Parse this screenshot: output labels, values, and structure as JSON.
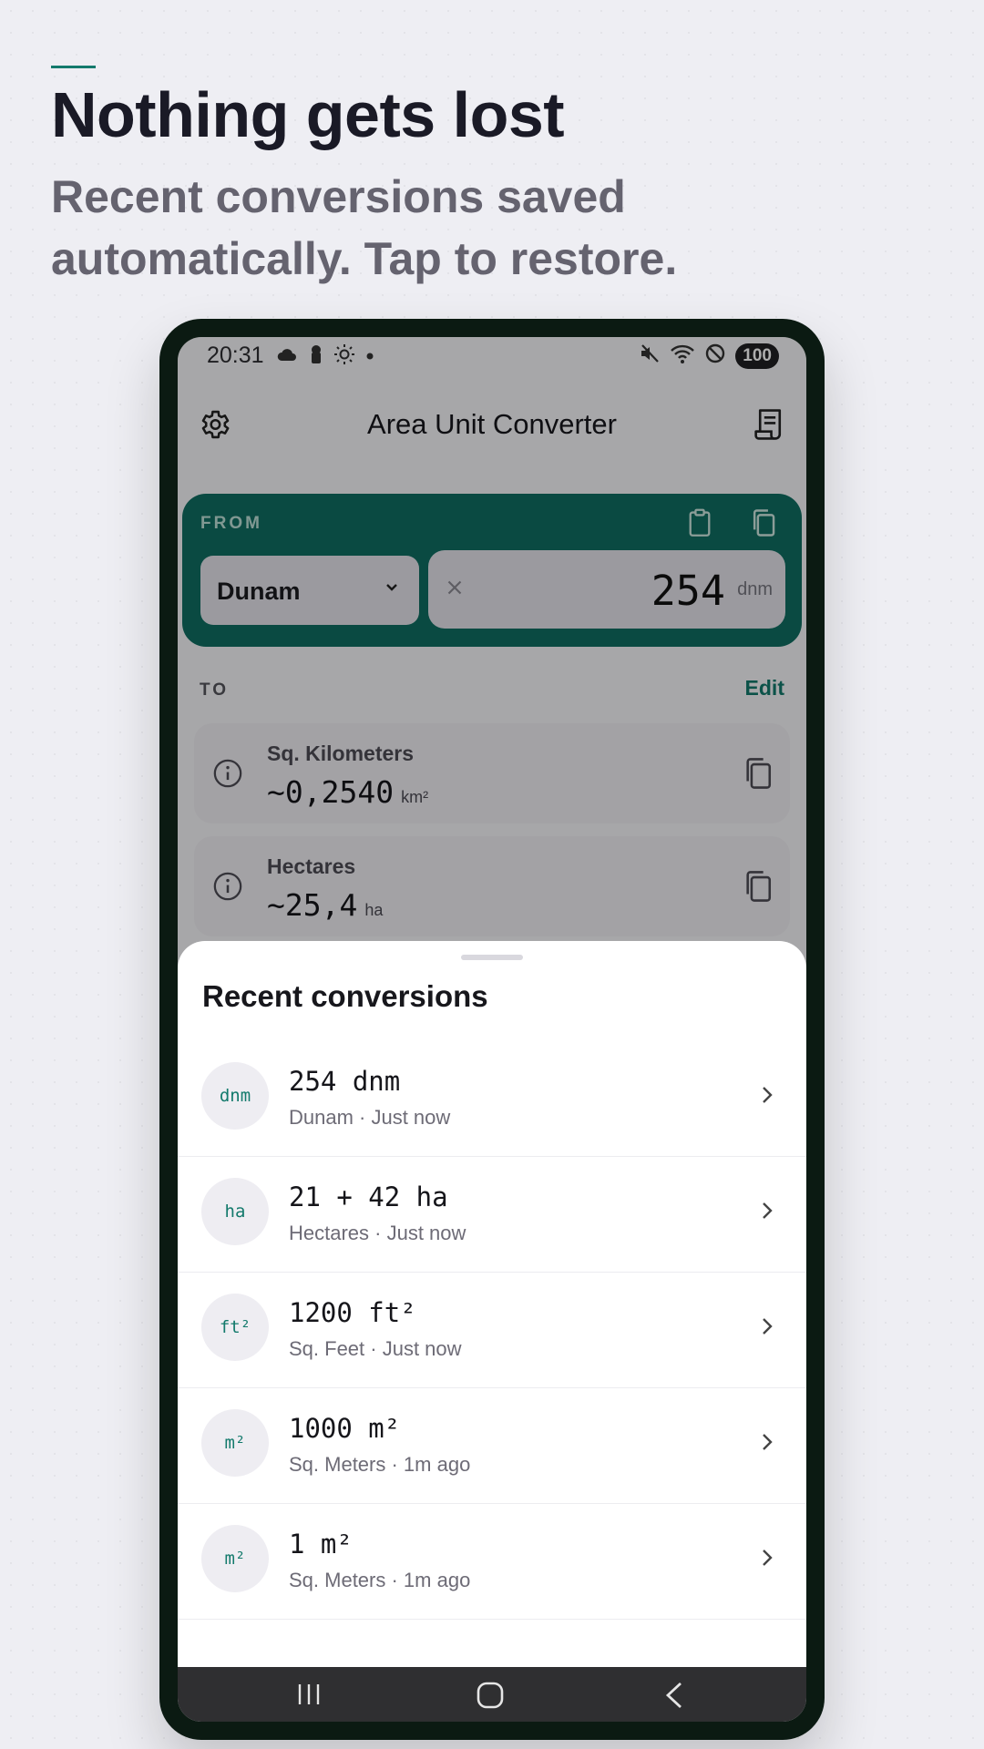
{
  "promo": {
    "headline": "Nothing gets lost",
    "subheadline": "Recent conversions saved automatically. Tap to restore."
  },
  "status_bar": {
    "time": "20:31",
    "battery": "100",
    "icons": [
      "cloud-icon",
      "lock-icon",
      "sun-icon",
      "dot-icon",
      "mute-icon",
      "wifi-icon",
      "blocked-icon"
    ]
  },
  "app_bar": {
    "title": "Area Unit Converter",
    "left_icon": "gear-icon",
    "right_icon": "history-receipt-icon"
  },
  "from": {
    "label": "FROM",
    "unit": "Dunam",
    "value": "254",
    "unit_symbol": "dnm"
  },
  "to": {
    "label": "TO",
    "edit_label": "Edit",
    "results": [
      {
        "name": "Sq. Kilometers",
        "value": "~0,2540",
        "unit": "km²"
      },
      {
        "name": "Hectares",
        "value": "~25,4",
        "unit": "ha"
      }
    ]
  },
  "recent": {
    "title": "Recent conversions",
    "items": [
      {
        "badge": "dnm",
        "title": "254 dnm",
        "subtitle": "Dunam · Just now"
      },
      {
        "badge": "ha",
        "title": "21 + 42 ha",
        "subtitle": "Hectares · Just now"
      },
      {
        "badge": "ft²",
        "title": "1200 ft²",
        "subtitle": "Sq. Feet · Just now"
      },
      {
        "badge": "m²",
        "title": "1000 m²",
        "subtitle": "Sq. Meters · 1m ago"
      },
      {
        "badge": "m²",
        "title": "1 m²",
        "subtitle": "Sq. Meters · 1m ago"
      }
    ]
  },
  "colors": {
    "accent": "#137a6c",
    "from_card": "#0f6e62",
    "phone_frame": "#0b1a12"
  }
}
